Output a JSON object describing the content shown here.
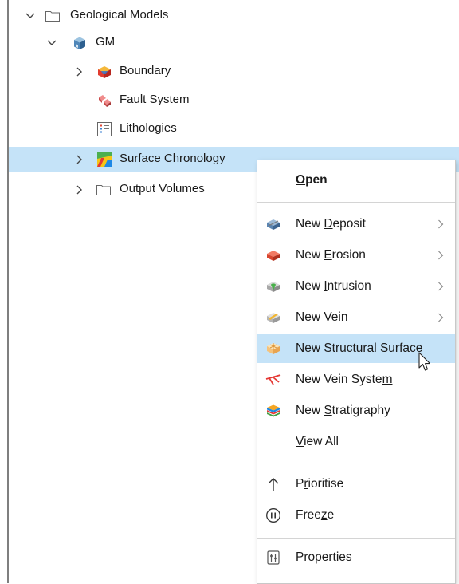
{
  "tree": {
    "geological_models": "Geological Models",
    "gm": "GM",
    "boundary": "Boundary",
    "fault_system": "Fault System",
    "lithologies": "Lithologies",
    "surface_chronology": "Surface Chronology",
    "output_volumes": "Output Volumes"
  },
  "menu": {
    "open": {
      "pre": "",
      "u": "O",
      "post": "pen"
    },
    "new_deposit": {
      "pre": "New ",
      "u": "D",
      "post": "eposit"
    },
    "new_erosion": {
      "pre": "New ",
      "u": "E",
      "post": "rosion"
    },
    "new_intrusion": {
      "pre": "New ",
      "u": "I",
      "post": "ntrusion"
    },
    "new_vein": {
      "pre": "New Ve",
      "u": "i",
      "post": "n"
    },
    "new_structural_surface": {
      "pre": "New Structura",
      "u": "l",
      "post": " Surface"
    },
    "new_vein_system": {
      "pre": "New Vein Syste",
      "u": "m",
      "post": ""
    },
    "new_stratigraphy": {
      "pre": "New ",
      "u": "S",
      "post": "tratigraphy"
    },
    "view_all": {
      "pre": "",
      "u": "V",
      "post": "iew All"
    },
    "prioritise": {
      "pre": "P",
      "u": "r",
      "post": "ioritise"
    },
    "freeze": {
      "pre": "Free",
      "u": "z",
      "post": "e"
    },
    "properties": {
      "pre": "",
      "u": "P",
      "post": "roperties"
    }
  }
}
